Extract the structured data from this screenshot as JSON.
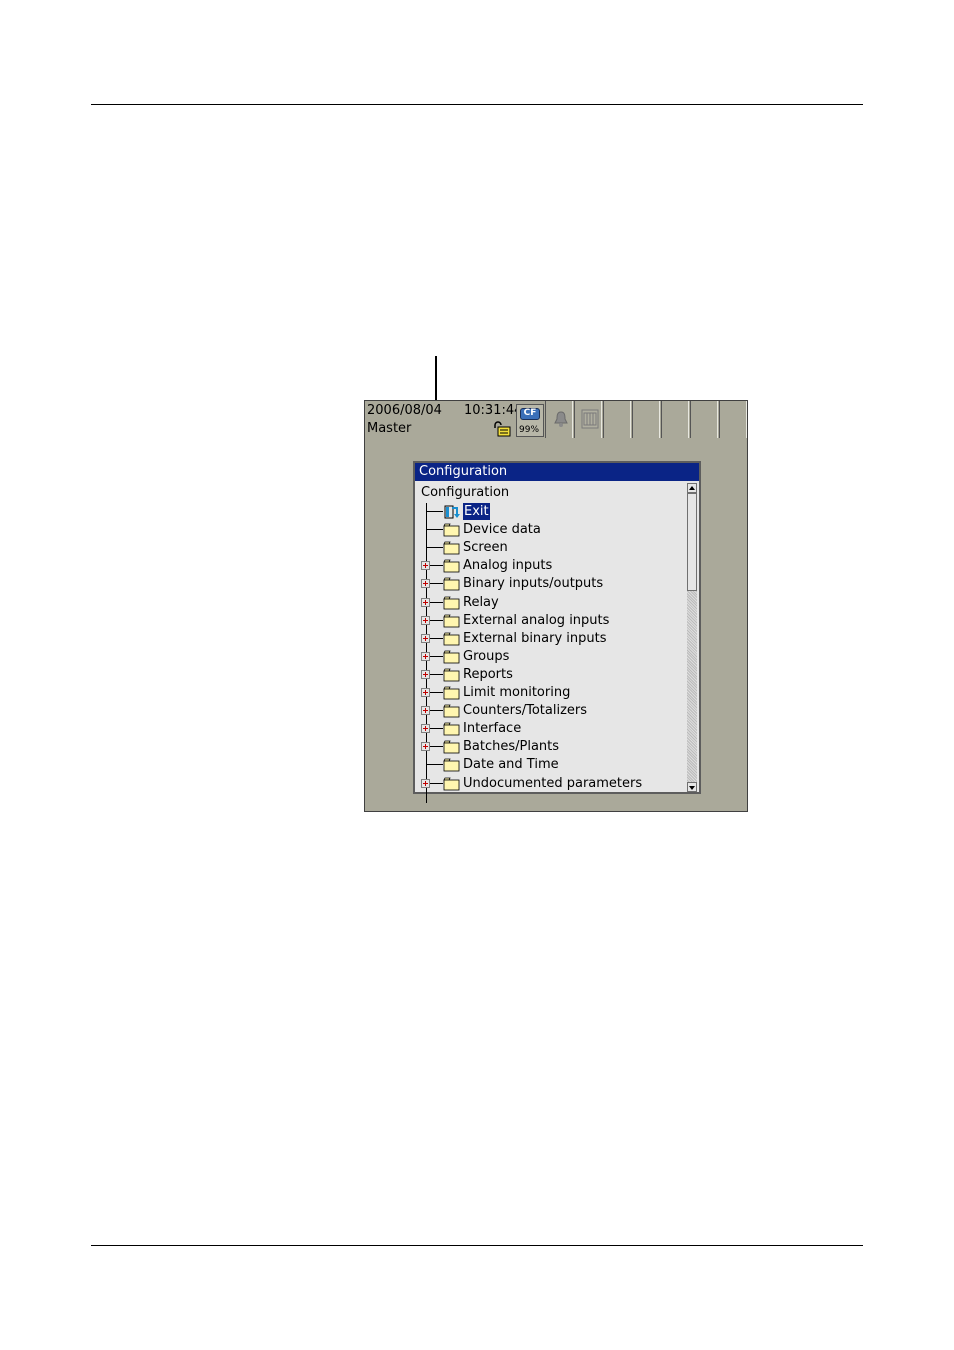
{
  "status_bar": {
    "date": "2006/08/04",
    "time": "10:31:44",
    "user": "Master",
    "cf_label": "CF",
    "cf_usage": "99%"
  },
  "window": {
    "title": "Configuration",
    "root_label": "Configuration",
    "items": [
      {
        "label": "Exit",
        "expandable": false,
        "selected": true,
        "icon": "exit-icon"
      },
      {
        "label": "Device data",
        "expandable": false,
        "selected": false,
        "icon": "folder-icon"
      },
      {
        "label": "Screen",
        "expandable": false,
        "selected": false,
        "icon": "folder-icon"
      },
      {
        "label": "Analog inputs",
        "expandable": true,
        "selected": false,
        "icon": "folder-icon"
      },
      {
        "label": "Binary inputs/outputs",
        "expandable": true,
        "selected": false,
        "icon": "folder-icon"
      },
      {
        "label": "Relay",
        "expandable": true,
        "selected": false,
        "icon": "folder-icon"
      },
      {
        "label": "External analog inputs",
        "expandable": true,
        "selected": false,
        "icon": "folder-icon"
      },
      {
        "label": "External binary inputs",
        "expandable": true,
        "selected": false,
        "icon": "folder-icon"
      },
      {
        "label": "Groups",
        "expandable": true,
        "selected": false,
        "icon": "folder-icon"
      },
      {
        "label": "Reports",
        "expandable": true,
        "selected": false,
        "icon": "folder-icon"
      },
      {
        "label": "Limit monitoring",
        "expandable": true,
        "selected": false,
        "icon": "folder-icon"
      },
      {
        "label": "Counters/Totalizers",
        "expandable": true,
        "selected": false,
        "icon": "folder-icon"
      },
      {
        "label": "Interface",
        "expandable": true,
        "selected": false,
        "icon": "folder-icon"
      },
      {
        "label": "Batches/Plants",
        "expandable": true,
        "selected": false,
        "icon": "folder-icon"
      },
      {
        "label": "Date and Time",
        "expandable": false,
        "selected": false,
        "icon": "folder-icon"
      },
      {
        "label": "Undocumented parameters",
        "expandable": true,
        "selected": false,
        "icon": "folder-icon"
      }
    ]
  },
  "colors": {
    "device_bg": "#aaa99a",
    "title_bar": "#0a2486",
    "window_bg": "#e6e6e6",
    "folder": "#fff6b0"
  }
}
